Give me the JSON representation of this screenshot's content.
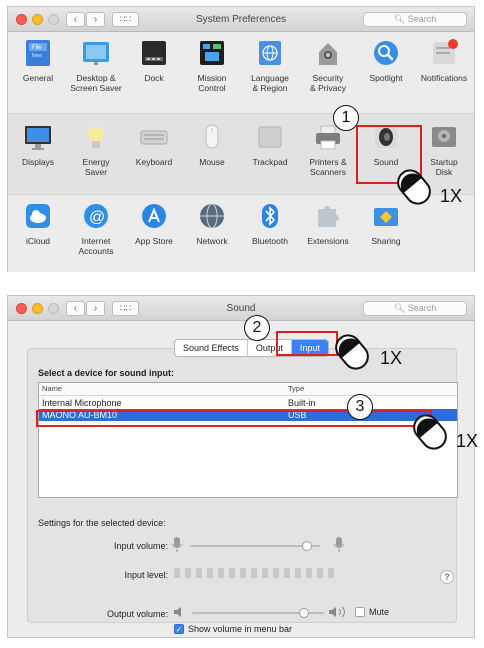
{
  "sysprefs": {
    "title": "System Preferences",
    "search_placeholder": "Search",
    "rows": [
      [
        {
          "label": "General",
          "icon": "general-icon"
        },
        {
          "label": "Desktop &\nScreen Saver",
          "icon": "desktop-icon"
        },
        {
          "label": "Dock",
          "icon": "dock-icon"
        },
        {
          "label": "Mission\nControl",
          "icon": "mission-control-icon"
        },
        {
          "label": "Language\n& Region",
          "icon": "language-icon"
        },
        {
          "label": "Security\n& Privacy",
          "icon": "security-icon"
        },
        {
          "label": "Spotlight",
          "icon": "spotlight-icon"
        },
        {
          "label": "Notifications",
          "icon": "notifications-icon"
        }
      ],
      [
        {
          "label": "Displays",
          "icon": "displays-icon"
        },
        {
          "label": "Energy\nSaver",
          "icon": "energy-icon"
        },
        {
          "label": "Keyboard",
          "icon": "keyboard-icon"
        },
        {
          "label": "Mouse",
          "icon": "mouse-icon"
        },
        {
          "label": "Trackpad",
          "icon": "trackpad-icon"
        },
        {
          "label": "Printers &\nScanners",
          "icon": "printer-icon"
        },
        {
          "label": "Sound",
          "icon": "speaker-icon"
        },
        {
          "label": "Startup\nDisk",
          "icon": "disk-icon"
        }
      ],
      [
        {
          "label": "iCloud",
          "icon": "cloud-icon"
        },
        {
          "label": "Internet\nAccounts",
          "icon": "at-icon"
        },
        {
          "label": "App Store",
          "icon": "appstore-icon"
        },
        {
          "label": "Network",
          "icon": "globe-icon"
        },
        {
          "label": "Bluetooth",
          "icon": "bluetooth-icon"
        },
        {
          "label": "Extensions",
          "icon": "puzzle-icon"
        },
        {
          "label": "Sharing",
          "icon": "sharing-icon"
        }
      ]
    ]
  },
  "sound": {
    "title": "Sound",
    "search_placeholder": "Search",
    "tabs": [
      {
        "label": "Sound Effects",
        "selected": false
      },
      {
        "label": "Output",
        "selected": false
      },
      {
        "label": "Input",
        "selected": true
      }
    ],
    "heading": "Select a device for sound input:",
    "columns": [
      "Name",
      "Type"
    ],
    "devices": [
      {
        "name": "Internal Microphone",
        "type": "Built-in",
        "selected": false
      },
      {
        "name": "MAONO AU-BM10",
        "type": "USB",
        "selected": true
      }
    ],
    "settings_label": "Settings for the selected device:",
    "input_volume_label": "Input volume:",
    "input_volume_value": 0.9,
    "input_level_label": "Input level:",
    "input_level_segments": 15,
    "output_volume_label": "Output volume:",
    "output_volume_value": 0.85,
    "mute_label": "Mute",
    "mute_checked": false,
    "show_volume_label": "Show volume in menu bar",
    "show_volume_checked": true
  },
  "annotations": {
    "step1": "1",
    "step2": "2",
    "step3": "3",
    "click": "1X"
  },
  "colors": {
    "highlight": "#e02020",
    "selection": "#2f6cd8",
    "accent": "#3b82f6"
  }
}
